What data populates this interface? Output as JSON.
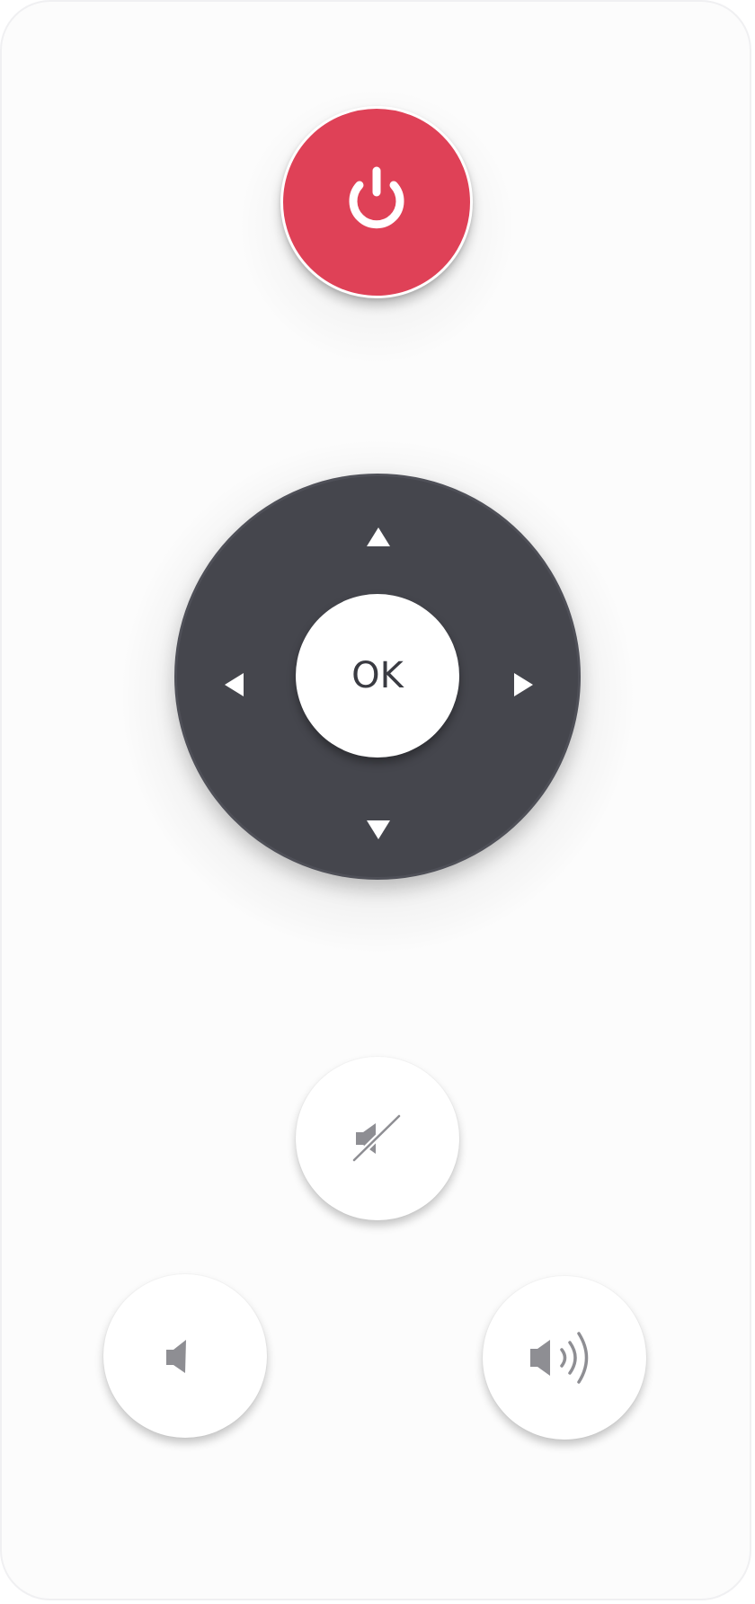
{
  "remote": {
    "power": {
      "icon": "power-icon",
      "color": "#df4157"
    },
    "dpad": {
      "ok_label": "OK",
      "up_icon": "triangle-up-icon",
      "down_icon": "triangle-down-icon",
      "left_icon": "triangle-left-icon",
      "right_icon": "triangle-right-icon",
      "color": "#45464d"
    },
    "volume": {
      "mute_icon": "speaker-mute-icon",
      "down_icon": "speaker-low-icon",
      "up_icon": "speaker-high-icon",
      "icon_color": "#8e8e93"
    }
  }
}
